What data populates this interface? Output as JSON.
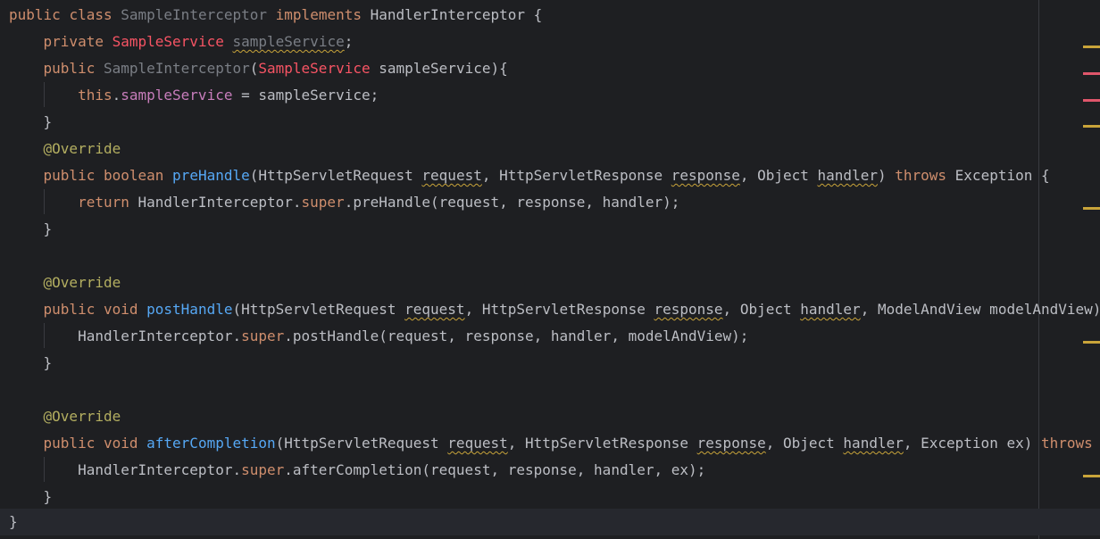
{
  "editor": {
    "lines": {
      "l1": {
        "public": "public",
        "class": "class",
        "name": "SampleInterceptor",
        "implements": "implements",
        "iface": "HandlerInterceptor",
        "brace": " {"
      },
      "l2": {
        "private": "private",
        "type": "SampleService",
        "field": "sampleService",
        "semi": ";"
      },
      "l3": {
        "public": "public",
        "ctor": "SampleInterceptor",
        "open": "(",
        "type": "SampleService",
        "rest": " sampleService){"
      },
      "l4": {
        "this": "this",
        "dot": ".",
        "field": "sampleService",
        "rest": " = sampleService;"
      },
      "l5": {
        "text": "}"
      },
      "l6": {
        "text": "@Override"
      },
      "l7": {
        "public": "public",
        "boolean": "boolean",
        "method": "preHandle",
        "p1": "(HttpServletRequest ",
        "request": "request",
        "p2": ", HttpServletResponse ",
        "response": "response",
        "p3": ", Object ",
        "handler": "handler",
        "p4": ") ",
        "throws": "throws",
        "p5": " Exception {"
      },
      "l8": {
        "return": "return",
        "a": " HandlerInterceptor.",
        "super": "super",
        "b": ".preHandle(request, response, handler);"
      },
      "l9": {
        "text": "}"
      },
      "l11": {
        "text": "@Override"
      },
      "l12": {
        "public": "public",
        "void": "void",
        "method": "postHandle",
        "p1": "(HttpServletRequest ",
        "request": "request",
        "p2": ", HttpServletResponse ",
        "response": "response",
        "p3": ", Object ",
        "handler": "handler",
        "p4": ", ModelAndView modelAndView)"
      },
      "l13": {
        "a": "HandlerInterceptor.",
        "super": "super",
        "b": ".postHandle(request, response, handler, modelAndView);"
      },
      "l14": {
        "text": "}"
      },
      "l16": {
        "text": "@Override"
      },
      "l17": {
        "public": "public",
        "void": "void",
        "method": "afterCompletion",
        "p1": "(HttpServletRequest ",
        "request": "request",
        "p2": ", HttpServletResponse ",
        "response": "response",
        "p3": ", Object ",
        "handler": "handler",
        "p4": ", Exception ex) ",
        "throws": "throws",
        "p5": " E"
      },
      "l18": {
        "a": "HandlerInterceptor.",
        "super": "super",
        "b": ".afterCompletion(request, response, handler, ex);"
      },
      "l19": {
        "text": "}"
      },
      "l20": {
        "text": "}"
      }
    },
    "colors": {
      "background": "#1e1f22",
      "keyword": "#cf8e6d",
      "error_type": "#f75464",
      "field": "#c77dbb",
      "method": "#56a8f5",
      "annotation": "#b3ae60",
      "warning_marker": "#c9a43a",
      "error_marker": "#e0566b"
    }
  }
}
